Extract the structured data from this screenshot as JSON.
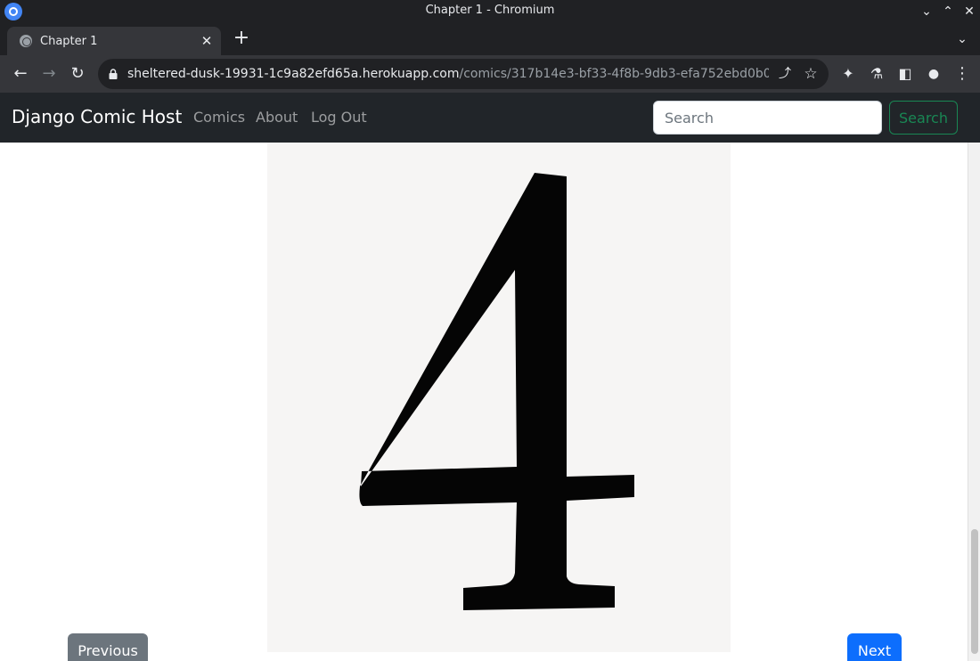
{
  "window": {
    "title": "Chapter 1 - Chromium",
    "controls": {
      "minimize": "⌄",
      "maximize": "⌃",
      "close": "✕"
    }
  },
  "tabs": [
    {
      "title": "Chapter 1",
      "active": true,
      "close": "✕"
    }
  ],
  "tabstrip": {
    "new_tab": "+",
    "tab_search": "⌄"
  },
  "toolbar": {
    "back": "←",
    "forward": "→",
    "reload": "↻",
    "url_host": "sheltered-dusk-19931-1c9a82efd65a.herokuapp.com",
    "url_path": "/comics/317b14e3-bf33-4f8b-9db3-efa752ebd0b0/ch...",
    "share": "⤴",
    "bookmark": "☆",
    "extensions": "✦",
    "labs": "⚗",
    "side_panel": "◧",
    "profile": "●",
    "menu": "⋮"
  },
  "navbar": {
    "brand": "Django Comic Host",
    "links": [
      "Comics",
      "About",
      "Log Out"
    ],
    "search_placeholder": "Search",
    "search_button": "Search"
  },
  "comic": {
    "page_glyph": "4"
  },
  "pager": {
    "previous": "Previous",
    "next": "Next"
  },
  "scrollbar": {
    "position_fraction": 0.75
  },
  "colors": {
    "navbar_bg": "#212529",
    "search_button": "#198754",
    "previous_button": "#6c757d",
    "next_button": "#0d6efd"
  }
}
